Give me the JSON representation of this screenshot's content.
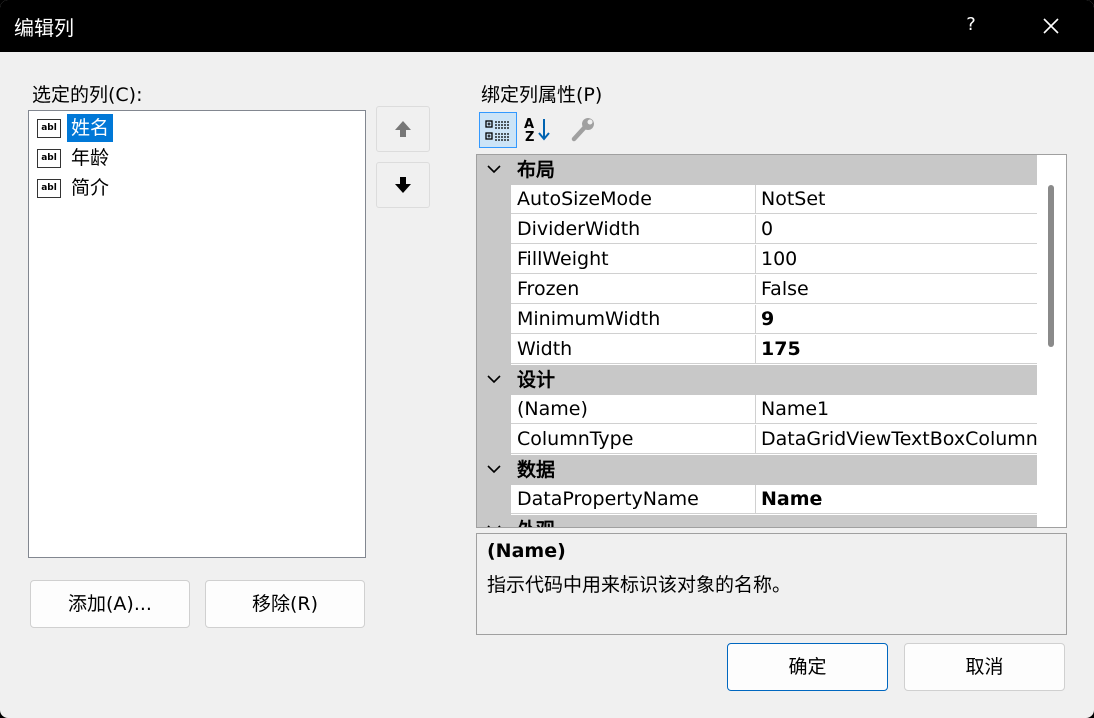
{
  "window": {
    "title": "编辑列",
    "help_label": "?"
  },
  "left": {
    "label": "选定的列(C):",
    "columns": [
      {
        "label": "姓名",
        "icon": "abl"
      },
      {
        "label": "年龄",
        "icon": "abl"
      },
      {
        "label": "简介",
        "icon": "abl"
      }
    ],
    "add_label": "添加(A)...",
    "remove_label": "移除(R)"
  },
  "right": {
    "label": "绑定列属性(P)",
    "properties": {
      "cat1": {
        "name": "布局"
      },
      "autosize": {
        "name": "AutoSizeMode",
        "value": "NotSet"
      },
      "divider": {
        "name": "DividerWidth",
        "value": "0"
      },
      "fill": {
        "name": "FillWeight",
        "value": "100"
      },
      "frozen": {
        "name": "Frozen",
        "value": "False"
      },
      "minwidth": {
        "name": "MinimumWidth",
        "value": "9"
      },
      "width": {
        "name": "Width",
        "value": "175"
      },
      "cat2": {
        "name": "设计"
      },
      "name": {
        "name": "(Name)",
        "value": "Name1"
      },
      "coltype": {
        "name": "ColumnType",
        "value": "DataGridViewTextBoxColumn"
      },
      "cat3": {
        "name": "数据"
      },
      "dataprop": {
        "name": "DataPropertyName",
        "value": "Name"
      },
      "cat4": {
        "name": "外观"
      }
    },
    "description": {
      "title": "(Name)",
      "text": "指示代码中用来标识该对象的名称。"
    }
  },
  "footer": {
    "ok_label": "确定",
    "cancel_label": "取消"
  },
  "colors": {
    "selection": "#0078d7",
    "category_bg": "#c8c8c8",
    "primary_border": "#0067c0"
  }
}
